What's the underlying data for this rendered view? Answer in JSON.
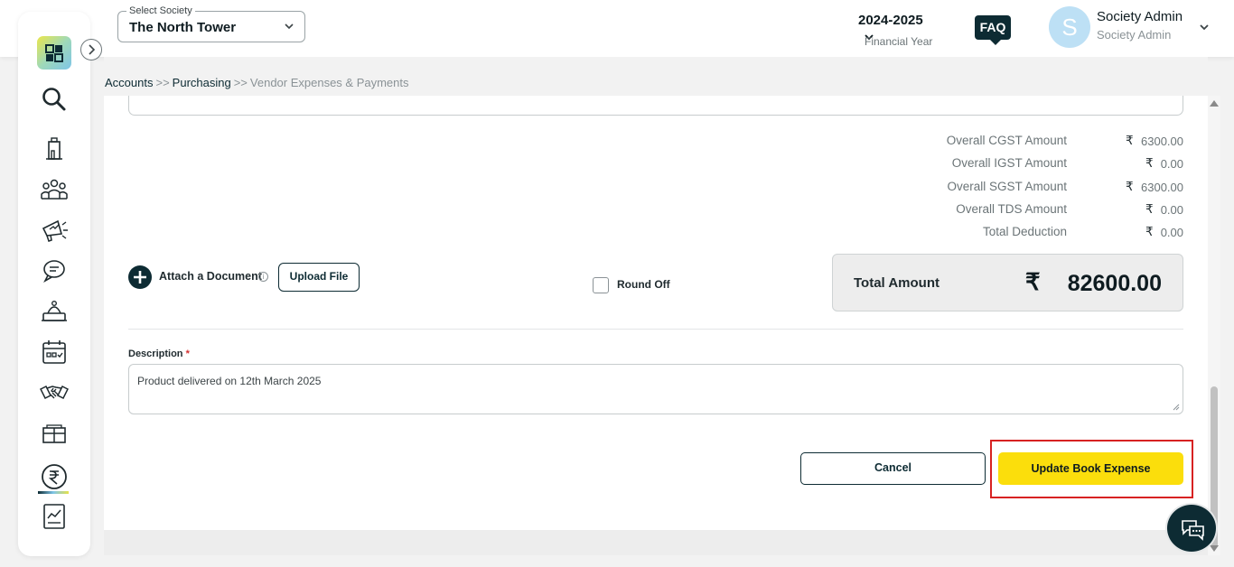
{
  "header": {
    "society_select": {
      "label": "Select Society",
      "value": "The North Tower"
    },
    "financial_year": {
      "value": "2024-2025",
      "caption": "Financial Year"
    },
    "faq_label": "FAQ",
    "user": {
      "avatar_initial": "S",
      "name": "Society Admin",
      "role": "Society Admin"
    }
  },
  "sidebar": {
    "items": [
      {
        "icon": "search-icon"
      },
      {
        "icon": "building-icon"
      },
      {
        "icon": "members-icon"
      },
      {
        "icon": "announcement-icon"
      },
      {
        "icon": "chat-icon"
      },
      {
        "icon": "service-bell-icon"
      },
      {
        "icon": "calendar-icon"
      },
      {
        "icon": "handshake-icon"
      },
      {
        "icon": "amenities-icon"
      },
      {
        "icon": "rupee-icon",
        "active": true
      },
      {
        "icon": "reports-icon"
      }
    ]
  },
  "breadcrumb": {
    "items": [
      "Accounts",
      "Purchasing",
      "Vendor Expenses & Payments"
    ],
    "separator": ">>"
  },
  "summary": {
    "currency_symbol": "₹",
    "rows": [
      {
        "label": "Overall CGST Amount",
        "amount": "6300.00"
      },
      {
        "label": "Overall IGST Amount",
        "amount": "0.00"
      },
      {
        "label": "Overall SGST Amount",
        "amount": "6300.00"
      },
      {
        "label": "Overall TDS Amount",
        "amount": "0.00"
      },
      {
        "label": "Total Deduction",
        "amount": "0.00"
      }
    ],
    "total_label": "Total Amount",
    "total_amount": "82600.00"
  },
  "attachment": {
    "label": "Attach a Document",
    "info_glyph": "i",
    "upload_label": "Upload File"
  },
  "round_off": {
    "label": "Round Off",
    "checked": false
  },
  "description": {
    "label": "Description",
    "required_mark": "*",
    "value": "Product delivered on 12th March 2025"
  },
  "actions": {
    "cancel_label": "Cancel",
    "update_label": "Update Book Expense"
  },
  "colors": {
    "primary": "#0d2b33",
    "accent_yellow": "#fbde0c",
    "highlight_red": "#d72222"
  }
}
